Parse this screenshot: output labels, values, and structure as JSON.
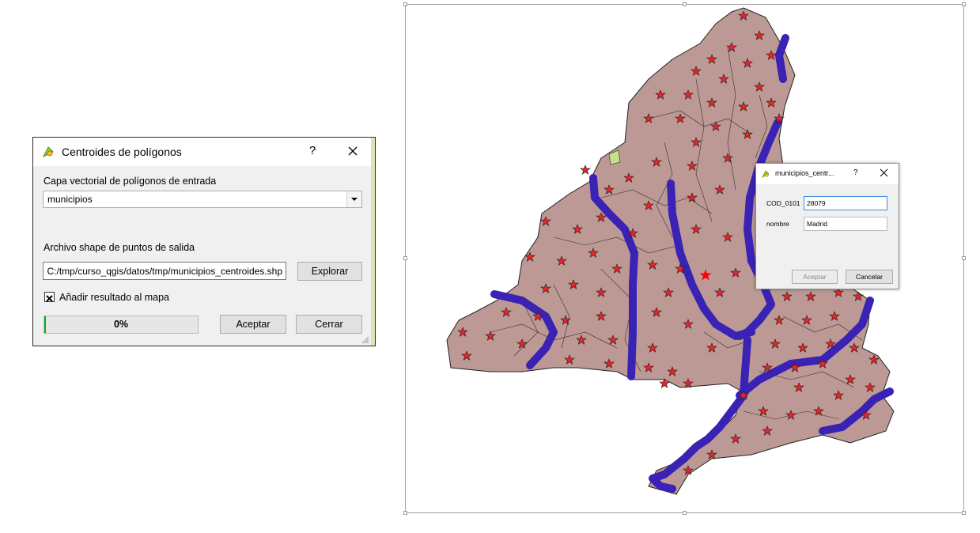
{
  "centroides_dialog": {
    "title": "Centroides de polígonos",
    "help": "?",
    "input_label": "Capa vectorial de polígonos de entrada",
    "input_value": "municipios",
    "output_label": "Archivo shape de puntos de salida",
    "output_value": "C:/tmp/curso_qgis/datos/tmp/municipios_centroides.shp",
    "browse_label": "Explorar",
    "add_result_label": "Añadir resultado al mapa",
    "add_result_checked": true,
    "progress_text": "0%",
    "progress_value": 0,
    "accept_label": "Aceptar",
    "close_label": "Cerrar",
    "icon": "qgis-app-icon"
  },
  "feature_dialog": {
    "title": "municipios_centr...",
    "help": "?",
    "fields": [
      {
        "label": "COD_0101",
        "value": "28079"
      },
      {
        "label": "nombre",
        "value": "Madrid"
      }
    ],
    "accept_label": "Aceptar",
    "cancel_label": "Cancelar"
  },
  "map": {
    "polygon_fill": "#bc9994",
    "river_color": "#3a22b5",
    "star_color": "#e8242b",
    "selected_star_color": "#ff0000"
  }
}
